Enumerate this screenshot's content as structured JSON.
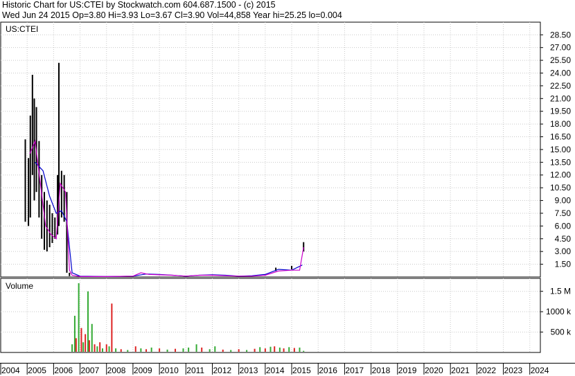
{
  "header": {
    "line1": "Historic Chart for US:CTEI by Stockwatch.com 604.687.1500 - (c) 2015",
    "line2": "Wed Jun 24 2015   Op=3.80  Hi=3.93  Lo=3.67  Cl=3.90  Vol=44,858  Year hi=25.25  lo=0.004"
  },
  "chart_data": [
    {
      "type": "line",
      "panel": "price",
      "panel_label": "US:CTEI",
      "ylim": [
        0,
        29.5
      ],
      "y_ticks": [
        "1.50",
        "3.00",
        "4.50",
        "6.00",
        "7.50",
        "9.00",
        "10.50",
        "12.00",
        "13.50",
        "15.00",
        "16.50",
        "18.00",
        "19.50",
        "21.00",
        "22.50",
        "24.00",
        "25.50",
        "27.00",
        "28.50"
      ],
      "y_tick_values": [
        1.5,
        3,
        4.5,
        6,
        7.5,
        9,
        10.5,
        12,
        13.5,
        15,
        16.5,
        18,
        19.5,
        21,
        22.5,
        24,
        25.5,
        27,
        28.5
      ],
      "x_range": [
        2004.0,
        2024.4
      ],
      "grid": true,
      "high_low_bars": [
        {
          "x": 2004.93,
          "lo": 6.5,
          "hi": 16.2
        },
        {
          "x": 2005.05,
          "lo": 6.0,
          "hi": 14.0
        },
        {
          "x": 2005.12,
          "lo": 7.0,
          "hi": 19.0
        },
        {
          "x": 2005.2,
          "lo": 12.0,
          "hi": 23.8
        },
        {
          "x": 2005.27,
          "lo": 9.0,
          "hi": 21.0
        },
        {
          "x": 2005.35,
          "lo": 10.0,
          "hi": 20.0
        },
        {
          "x": 2005.45,
          "lo": 7.0,
          "hi": 16.0
        },
        {
          "x": 2005.55,
          "lo": 4.5,
          "hi": 12.0
        },
        {
          "x": 2005.65,
          "lo": 3.2,
          "hi": 10.0
        },
        {
          "x": 2005.75,
          "lo": 3.0,
          "hi": 9.0
        },
        {
          "x": 2005.85,
          "lo": 3.5,
          "hi": 8.5
        },
        {
          "x": 2005.95,
          "lo": 4.0,
          "hi": 7.5
        },
        {
          "x": 2006.05,
          "lo": 4.5,
          "hi": 7.0
        },
        {
          "x": 2006.15,
          "lo": 5.0,
          "hi": 12.0
        },
        {
          "x": 2006.2,
          "lo": 6.0,
          "hi": 25.2
        },
        {
          "x": 2006.3,
          "lo": 7.0,
          "hi": 12.5
        },
        {
          "x": 2006.4,
          "lo": 6.5,
          "hi": 12.0
        },
        {
          "x": 2006.5,
          "lo": 0.5,
          "hi": 10.0
        },
        {
          "x": 2006.6,
          "lo": 0.1,
          "hi": 0.5
        },
        {
          "x": 2014.4,
          "lo": 0.7,
          "hi": 1.1
        },
        {
          "x": 2015.0,
          "lo": 0.9,
          "hi": 1.3
        },
        {
          "x": 2015.45,
          "lo": 3.0,
          "hi": 4.1
        }
      ],
      "series": [
        {
          "color": "#0000cc",
          "x": [
            2005.3,
            2005.6,
            2005.85,
            2006.1,
            2006.3,
            2006.5,
            2006.7,
            2007.0,
            2008.0,
            2009.0,
            2009.5,
            2010.0,
            2010.5,
            2011.0,
            2011.5,
            2012.0,
            2012.5,
            2013.0,
            2013.5,
            2014.0,
            2014.5,
            2015.0,
            2015.4
          ],
          "values": [
            13.5,
            12.5,
            9.5,
            7.5,
            7.8,
            6.5,
            0.5,
            0.1,
            0.05,
            0.1,
            0.35,
            0.3,
            0.2,
            0.1,
            0.2,
            0.25,
            0.2,
            0.1,
            0.15,
            0.3,
            0.9,
            0.8,
            1.4
          ]
        },
        {
          "color": "#cc00cc",
          "x": [
            2005.1,
            2005.3,
            2005.5,
            2005.7,
            2005.9,
            2006.1,
            2006.25,
            2006.45,
            2006.6,
            2006.7,
            2007.0,
            2008.0,
            2009.0,
            2009.3,
            2009.6,
            2010.0,
            2010.5,
            2011.0,
            2011.5,
            2012.0,
            2012.5,
            2013.0,
            2013.5,
            2014.0,
            2014.5,
            2015.0,
            2015.3,
            2015.45
          ],
          "values": [
            14.5,
            16.0,
            11.0,
            6.0,
            5.0,
            4.5,
            11.0,
            10.0,
            0.8,
            0.2,
            0.05,
            0.05,
            0.1,
            0.5,
            0.3,
            0.25,
            0.2,
            0.1,
            0.2,
            0.2,
            0.15,
            0.1,
            0.1,
            0.2,
            0.7,
            0.8,
            0.8,
            3.5
          ]
        }
      ]
    },
    {
      "type": "bar",
      "panel": "volume",
      "panel_label": "Volume",
      "ylim": [
        0,
        1750000
      ],
      "y_ticks": [
        "500 k",
        "1000 k",
        "1.5 M"
      ],
      "y_tick_values": [
        500000,
        1000000,
        1500000
      ],
      "x_range": [
        2004.0,
        2024.4
      ],
      "grid": true,
      "bars": [
        {
          "x": 2006.7,
          "v": 200000,
          "c": "g"
        },
        {
          "x": 2006.8,
          "v": 900000,
          "c": "g"
        },
        {
          "x": 2006.85,
          "v": 350000,
          "c": "r"
        },
        {
          "x": 2006.95,
          "v": 1700000,
          "c": "g"
        },
        {
          "x": 2007.05,
          "v": 600000,
          "c": "r"
        },
        {
          "x": 2007.12,
          "v": 250000,
          "c": "g"
        },
        {
          "x": 2007.2,
          "v": 450000,
          "c": "r"
        },
        {
          "x": 2007.3,
          "v": 1500000,
          "c": "g"
        },
        {
          "x": 2007.35,
          "v": 300000,
          "c": "r"
        },
        {
          "x": 2007.45,
          "v": 700000,
          "c": "g"
        },
        {
          "x": 2007.55,
          "v": 200000,
          "c": "r"
        },
        {
          "x": 2007.65,
          "v": 150000,
          "c": "g"
        },
        {
          "x": 2007.75,
          "v": 250000,
          "c": "r"
        },
        {
          "x": 2007.85,
          "v": 100000,
          "c": "g"
        },
        {
          "x": 2008.0,
          "v": 200000,
          "c": "r"
        },
        {
          "x": 2008.1,
          "v": 150000,
          "c": "g"
        },
        {
          "x": 2008.2,
          "v": 1200000,
          "c": "r"
        },
        {
          "x": 2008.35,
          "v": 100000,
          "c": "g"
        },
        {
          "x": 2008.55,
          "v": 80000,
          "c": "r"
        },
        {
          "x": 2008.8,
          "v": 60000,
          "c": "g"
        },
        {
          "x": 2009.1,
          "v": 150000,
          "c": "r"
        },
        {
          "x": 2009.3,
          "v": 100000,
          "c": "g"
        },
        {
          "x": 2009.5,
          "v": 80000,
          "c": "r"
        },
        {
          "x": 2009.7,
          "v": 120000,
          "c": "g"
        },
        {
          "x": 2010.0,
          "v": 100000,
          "c": "r"
        },
        {
          "x": 2010.3,
          "v": 70000,
          "c": "g"
        },
        {
          "x": 2010.6,
          "v": 90000,
          "c": "r"
        },
        {
          "x": 2010.9,
          "v": 100000,
          "c": "g"
        },
        {
          "x": 2011.1,
          "v": 120000,
          "c": "g"
        },
        {
          "x": 2011.4,
          "v": 200000,
          "c": "g"
        },
        {
          "x": 2011.6,
          "v": 120000,
          "c": "r"
        },
        {
          "x": 2011.9,
          "v": 80000,
          "c": "g"
        },
        {
          "x": 2012.1,
          "v": 150000,
          "c": "g"
        },
        {
          "x": 2012.4,
          "v": 70000,
          "c": "r"
        },
        {
          "x": 2012.7,
          "v": 60000,
          "c": "g"
        },
        {
          "x": 2013.0,
          "v": 80000,
          "c": "r"
        },
        {
          "x": 2013.3,
          "v": 60000,
          "c": "g"
        },
        {
          "x": 2013.6,
          "v": 90000,
          "c": "r"
        },
        {
          "x": 2013.8,
          "v": 130000,
          "c": "g"
        },
        {
          "x": 2014.0,
          "v": 100000,
          "c": "r"
        },
        {
          "x": 2014.2,
          "v": 140000,
          "c": "g"
        },
        {
          "x": 2014.35,
          "v": 150000,
          "c": "r"
        },
        {
          "x": 2014.55,
          "v": 120000,
          "c": "g"
        },
        {
          "x": 2014.7,
          "v": 100000,
          "c": "r"
        },
        {
          "x": 2014.9,
          "v": 130000,
          "c": "g"
        },
        {
          "x": 2015.1,
          "v": 110000,
          "c": "r"
        },
        {
          "x": 2015.3,
          "v": 120000,
          "c": "g"
        },
        {
          "x": 2015.45,
          "v": 40000,
          "c": "g"
        }
      ]
    }
  ],
  "x_ticks": [
    "2004",
    "2005",
    "2006",
    "2007",
    "2008",
    "2009",
    "2010",
    "2011",
    "2012",
    "2013",
    "2014",
    "2015",
    "2016",
    "2017",
    "2018",
    "2019",
    "2020",
    "2021",
    "2022",
    "2023",
    "2024"
  ],
  "colors": {
    "grid": "#c8c8c8",
    "up_volume": "#33aa33",
    "down_volume": "#dd2222",
    "price_bar": "#000000",
    "ma_short": "#cc00cc",
    "ma_long": "#0000cc"
  }
}
